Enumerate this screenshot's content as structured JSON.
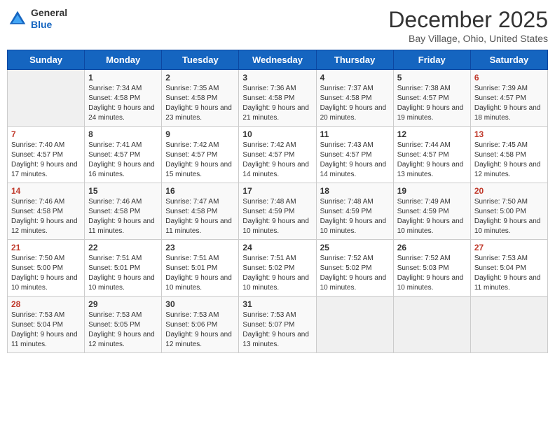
{
  "header": {
    "logo_general": "General",
    "logo_blue": "Blue",
    "title": "December 2025",
    "location": "Bay Village, Ohio, United States"
  },
  "days_of_week": [
    "Sunday",
    "Monday",
    "Tuesday",
    "Wednesday",
    "Thursday",
    "Friday",
    "Saturday"
  ],
  "weeks": [
    [
      {
        "day": "",
        "sunrise": "",
        "sunset": "",
        "daylight": ""
      },
      {
        "day": "1",
        "sunrise": "Sunrise: 7:34 AM",
        "sunset": "Sunset: 4:58 PM",
        "daylight": "Daylight: 9 hours and 24 minutes."
      },
      {
        "day": "2",
        "sunrise": "Sunrise: 7:35 AM",
        "sunset": "Sunset: 4:58 PM",
        "daylight": "Daylight: 9 hours and 23 minutes."
      },
      {
        "day": "3",
        "sunrise": "Sunrise: 7:36 AM",
        "sunset": "Sunset: 4:58 PM",
        "daylight": "Daylight: 9 hours and 21 minutes."
      },
      {
        "day": "4",
        "sunrise": "Sunrise: 7:37 AM",
        "sunset": "Sunset: 4:58 PM",
        "daylight": "Daylight: 9 hours and 20 minutes."
      },
      {
        "day": "5",
        "sunrise": "Sunrise: 7:38 AM",
        "sunset": "Sunset: 4:57 PM",
        "daylight": "Daylight: 9 hours and 19 minutes."
      },
      {
        "day": "6",
        "sunrise": "Sunrise: 7:39 AM",
        "sunset": "Sunset: 4:57 PM",
        "daylight": "Daylight: 9 hours and 18 minutes."
      }
    ],
    [
      {
        "day": "7",
        "sunrise": "Sunrise: 7:40 AM",
        "sunset": "Sunset: 4:57 PM",
        "daylight": "Daylight: 9 hours and 17 minutes."
      },
      {
        "day": "8",
        "sunrise": "Sunrise: 7:41 AM",
        "sunset": "Sunset: 4:57 PM",
        "daylight": "Daylight: 9 hours and 16 minutes."
      },
      {
        "day": "9",
        "sunrise": "Sunrise: 7:42 AM",
        "sunset": "Sunset: 4:57 PM",
        "daylight": "Daylight: 9 hours and 15 minutes."
      },
      {
        "day": "10",
        "sunrise": "Sunrise: 7:42 AM",
        "sunset": "Sunset: 4:57 PM",
        "daylight": "Daylight: 9 hours and 14 minutes."
      },
      {
        "day": "11",
        "sunrise": "Sunrise: 7:43 AM",
        "sunset": "Sunset: 4:57 PM",
        "daylight": "Daylight: 9 hours and 14 minutes."
      },
      {
        "day": "12",
        "sunrise": "Sunrise: 7:44 AM",
        "sunset": "Sunset: 4:57 PM",
        "daylight": "Daylight: 9 hours and 13 minutes."
      },
      {
        "day": "13",
        "sunrise": "Sunrise: 7:45 AM",
        "sunset": "Sunset: 4:58 PM",
        "daylight": "Daylight: 9 hours and 12 minutes."
      }
    ],
    [
      {
        "day": "14",
        "sunrise": "Sunrise: 7:46 AM",
        "sunset": "Sunset: 4:58 PM",
        "daylight": "Daylight: 9 hours and 12 minutes."
      },
      {
        "day": "15",
        "sunrise": "Sunrise: 7:46 AM",
        "sunset": "Sunset: 4:58 PM",
        "daylight": "Daylight: 9 hours and 11 minutes."
      },
      {
        "day": "16",
        "sunrise": "Sunrise: 7:47 AM",
        "sunset": "Sunset: 4:58 PM",
        "daylight": "Daylight: 9 hours and 11 minutes."
      },
      {
        "day": "17",
        "sunrise": "Sunrise: 7:48 AM",
        "sunset": "Sunset: 4:59 PM",
        "daylight": "Daylight: 9 hours and 10 minutes."
      },
      {
        "day": "18",
        "sunrise": "Sunrise: 7:48 AM",
        "sunset": "Sunset: 4:59 PM",
        "daylight": "Daylight: 9 hours and 10 minutes."
      },
      {
        "day": "19",
        "sunrise": "Sunrise: 7:49 AM",
        "sunset": "Sunset: 4:59 PM",
        "daylight": "Daylight: 9 hours and 10 minutes."
      },
      {
        "day": "20",
        "sunrise": "Sunrise: 7:50 AM",
        "sunset": "Sunset: 5:00 PM",
        "daylight": "Daylight: 9 hours and 10 minutes."
      }
    ],
    [
      {
        "day": "21",
        "sunrise": "Sunrise: 7:50 AM",
        "sunset": "Sunset: 5:00 PM",
        "daylight": "Daylight: 9 hours and 10 minutes."
      },
      {
        "day": "22",
        "sunrise": "Sunrise: 7:51 AM",
        "sunset": "Sunset: 5:01 PM",
        "daylight": "Daylight: 9 hours and 10 minutes."
      },
      {
        "day": "23",
        "sunrise": "Sunrise: 7:51 AM",
        "sunset": "Sunset: 5:01 PM",
        "daylight": "Daylight: 9 hours and 10 minutes."
      },
      {
        "day": "24",
        "sunrise": "Sunrise: 7:51 AM",
        "sunset": "Sunset: 5:02 PM",
        "daylight": "Daylight: 9 hours and 10 minutes."
      },
      {
        "day": "25",
        "sunrise": "Sunrise: 7:52 AM",
        "sunset": "Sunset: 5:02 PM",
        "daylight": "Daylight: 9 hours and 10 minutes."
      },
      {
        "day": "26",
        "sunrise": "Sunrise: 7:52 AM",
        "sunset": "Sunset: 5:03 PM",
        "daylight": "Daylight: 9 hours and 10 minutes."
      },
      {
        "day": "27",
        "sunrise": "Sunrise: 7:53 AM",
        "sunset": "Sunset: 5:04 PM",
        "daylight": "Daylight: 9 hours and 11 minutes."
      }
    ],
    [
      {
        "day": "28",
        "sunrise": "Sunrise: 7:53 AM",
        "sunset": "Sunset: 5:04 PM",
        "daylight": "Daylight: 9 hours and 11 minutes."
      },
      {
        "day": "29",
        "sunrise": "Sunrise: 7:53 AM",
        "sunset": "Sunset: 5:05 PM",
        "daylight": "Daylight: 9 hours and 12 minutes."
      },
      {
        "day": "30",
        "sunrise": "Sunrise: 7:53 AM",
        "sunset": "Sunset: 5:06 PM",
        "daylight": "Daylight: 9 hours and 12 minutes."
      },
      {
        "day": "31",
        "sunrise": "Sunrise: 7:53 AM",
        "sunset": "Sunset: 5:07 PM",
        "daylight": "Daylight: 9 hours and 13 minutes."
      },
      {
        "day": "",
        "sunrise": "",
        "sunset": "",
        "daylight": ""
      },
      {
        "day": "",
        "sunrise": "",
        "sunset": "",
        "daylight": ""
      },
      {
        "day": "",
        "sunrise": "",
        "sunset": "",
        "daylight": ""
      }
    ]
  ]
}
